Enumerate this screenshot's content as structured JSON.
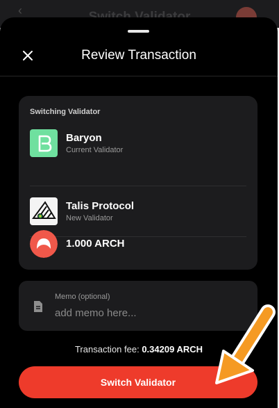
{
  "background_page": {
    "back_icon": "chevron-left-icon",
    "title": "Switch Validator"
  },
  "sheet": {
    "title": "Review Transaction",
    "close_icon": "close-icon"
  },
  "summary": {
    "heading": "Switching Validator",
    "current": {
      "name": "Baryon",
      "subtitle": "Current Validator",
      "logo_icon": "baryon-logo-icon"
    },
    "new": {
      "name": "Talis Protocol",
      "subtitle": "New Validator",
      "logo_icon": "talis-protocol-logo-icon"
    },
    "amount": {
      "value": "1.000 ARCH",
      "token_icon": "arch-token-icon"
    }
  },
  "memo": {
    "label": "Memo (optional)",
    "placeholder": "add memo here...",
    "value": "",
    "icon": "document-icon"
  },
  "fee": {
    "label": "Transaction fee:",
    "value": "0.34209 ARCH"
  },
  "actions": {
    "confirm_label": "Switch Validator"
  },
  "colors": {
    "accent": "#ee3b2b",
    "sheet_background": "#000000",
    "card_background": "#1c1c1e",
    "annotation_arrow": "#f59a23"
  }
}
